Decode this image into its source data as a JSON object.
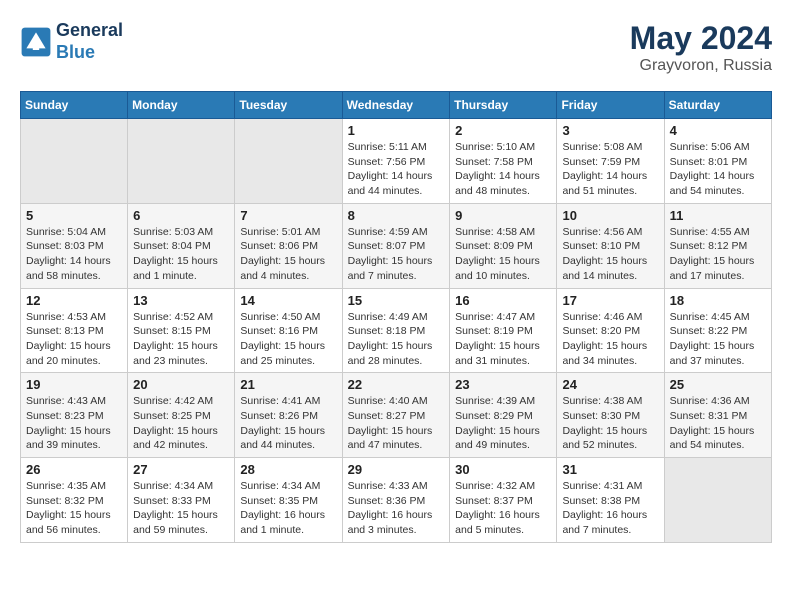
{
  "logo": {
    "line1": "General",
    "line2": "Blue"
  },
  "title": "May 2024",
  "location": "Grayvoron, Russia",
  "days_header": [
    "Sunday",
    "Monday",
    "Tuesday",
    "Wednesday",
    "Thursday",
    "Friday",
    "Saturday"
  ],
  "weeks": [
    [
      {
        "day": "",
        "sunrise": "",
        "sunset": "",
        "daylight": "",
        "empty": true
      },
      {
        "day": "",
        "sunrise": "",
        "sunset": "",
        "daylight": "",
        "empty": true
      },
      {
        "day": "",
        "sunrise": "",
        "sunset": "",
        "daylight": "",
        "empty": true
      },
      {
        "day": "1",
        "sunrise": "Sunrise: 5:11 AM",
        "sunset": "Sunset: 7:56 PM",
        "daylight": "Daylight: 14 hours and 44 minutes."
      },
      {
        "day": "2",
        "sunrise": "Sunrise: 5:10 AM",
        "sunset": "Sunset: 7:58 PM",
        "daylight": "Daylight: 14 hours and 48 minutes."
      },
      {
        "day": "3",
        "sunrise": "Sunrise: 5:08 AM",
        "sunset": "Sunset: 7:59 PM",
        "daylight": "Daylight: 14 hours and 51 minutes."
      },
      {
        "day": "4",
        "sunrise": "Sunrise: 5:06 AM",
        "sunset": "Sunset: 8:01 PM",
        "daylight": "Daylight: 14 hours and 54 minutes."
      }
    ],
    [
      {
        "day": "5",
        "sunrise": "Sunrise: 5:04 AM",
        "sunset": "Sunset: 8:03 PM",
        "daylight": "Daylight: 14 hours and 58 minutes."
      },
      {
        "day": "6",
        "sunrise": "Sunrise: 5:03 AM",
        "sunset": "Sunset: 8:04 PM",
        "daylight": "Daylight: 15 hours and 1 minute."
      },
      {
        "day": "7",
        "sunrise": "Sunrise: 5:01 AM",
        "sunset": "Sunset: 8:06 PM",
        "daylight": "Daylight: 15 hours and 4 minutes."
      },
      {
        "day": "8",
        "sunrise": "Sunrise: 4:59 AM",
        "sunset": "Sunset: 8:07 PM",
        "daylight": "Daylight: 15 hours and 7 minutes."
      },
      {
        "day": "9",
        "sunrise": "Sunrise: 4:58 AM",
        "sunset": "Sunset: 8:09 PM",
        "daylight": "Daylight: 15 hours and 10 minutes."
      },
      {
        "day": "10",
        "sunrise": "Sunrise: 4:56 AM",
        "sunset": "Sunset: 8:10 PM",
        "daylight": "Daylight: 15 hours and 14 minutes."
      },
      {
        "day": "11",
        "sunrise": "Sunrise: 4:55 AM",
        "sunset": "Sunset: 8:12 PM",
        "daylight": "Daylight: 15 hours and 17 minutes."
      }
    ],
    [
      {
        "day": "12",
        "sunrise": "Sunrise: 4:53 AM",
        "sunset": "Sunset: 8:13 PM",
        "daylight": "Daylight: 15 hours and 20 minutes."
      },
      {
        "day": "13",
        "sunrise": "Sunrise: 4:52 AM",
        "sunset": "Sunset: 8:15 PM",
        "daylight": "Daylight: 15 hours and 23 minutes."
      },
      {
        "day": "14",
        "sunrise": "Sunrise: 4:50 AM",
        "sunset": "Sunset: 8:16 PM",
        "daylight": "Daylight: 15 hours and 25 minutes."
      },
      {
        "day": "15",
        "sunrise": "Sunrise: 4:49 AM",
        "sunset": "Sunset: 8:18 PM",
        "daylight": "Daylight: 15 hours and 28 minutes."
      },
      {
        "day": "16",
        "sunrise": "Sunrise: 4:47 AM",
        "sunset": "Sunset: 8:19 PM",
        "daylight": "Daylight: 15 hours and 31 minutes."
      },
      {
        "day": "17",
        "sunrise": "Sunrise: 4:46 AM",
        "sunset": "Sunset: 8:20 PM",
        "daylight": "Daylight: 15 hours and 34 minutes."
      },
      {
        "day": "18",
        "sunrise": "Sunrise: 4:45 AM",
        "sunset": "Sunset: 8:22 PM",
        "daylight": "Daylight: 15 hours and 37 minutes."
      }
    ],
    [
      {
        "day": "19",
        "sunrise": "Sunrise: 4:43 AM",
        "sunset": "Sunset: 8:23 PM",
        "daylight": "Daylight: 15 hours and 39 minutes."
      },
      {
        "day": "20",
        "sunrise": "Sunrise: 4:42 AM",
        "sunset": "Sunset: 8:25 PM",
        "daylight": "Daylight: 15 hours and 42 minutes."
      },
      {
        "day": "21",
        "sunrise": "Sunrise: 4:41 AM",
        "sunset": "Sunset: 8:26 PM",
        "daylight": "Daylight: 15 hours and 44 minutes."
      },
      {
        "day": "22",
        "sunrise": "Sunrise: 4:40 AM",
        "sunset": "Sunset: 8:27 PM",
        "daylight": "Daylight: 15 hours and 47 minutes."
      },
      {
        "day": "23",
        "sunrise": "Sunrise: 4:39 AM",
        "sunset": "Sunset: 8:29 PM",
        "daylight": "Daylight: 15 hours and 49 minutes."
      },
      {
        "day": "24",
        "sunrise": "Sunrise: 4:38 AM",
        "sunset": "Sunset: 8:30 PM",
        "daylight": "Daylight: 15 hours and 52 minutes."
      },
      {
        "day": "25",
        "sunrise": "Sunrise: 4:36 AM",
        "sunset": "Sunset: 8:31 PM",
        "daylight": "Daylight: 15 hours and 54 minutes."
      }
    ],
    [
      {
        "day": "26",
        "sunrise": "Sunrise: 4:35 AM",
        "sunset": "Sunset: 8:32 PM",
        "daylight": "Daylight: 15 hours and 56 minutes."
      },
      {
        "day": "27",
        "sunrise": "Sunrise: 4:34 AM",
        "sunset": "Sunset: 8:33 PM",
        "daylight": "Daylight: 15 hours and 59 minutes."
      },
      {
        "day": "28",
        "sunrise": "Sunrise: 4:34 AM",
        "sunset": "Sunset: 8:35 PM",
        "daylight": "Daylight: 16 hours and 1 minute."
      },
      {
        "day": "29",
        "sunrise": "Sunrise: 4:33 AM",
        "sunset": "Sunset: 8:36 PM",
        "daylight": "Daylight: 16 hours and 3 minutes."
      },
      {
        "day": "30",
        "sunrise": "Sunrise: 4:32 AM",
        "sunset": "Sunset: 8:37 PM",
        "daylight": "Daylight: 16 hours and 5 minutes."
      },
      {
        "day": "31",
        "sunrise": "Sunrise: 4:31 AM",
        "sunset": "Sunset: 8:38 PM",
        "daylight": "Daylight: 16 hours and 7 minutes."
      },
      {
        "day": "",
        "sunrise": "",
        "sunset": "",
        "daylight": "",
        "empty": true
      }
    ]
  ]
}
